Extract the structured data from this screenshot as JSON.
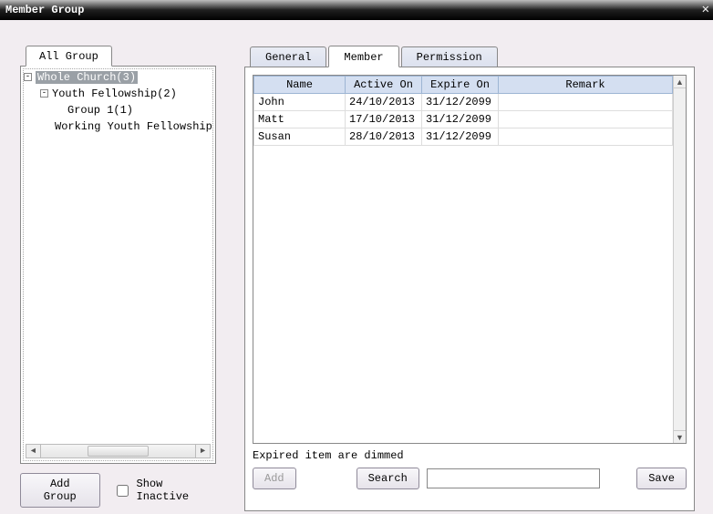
{
  "window": {
    "title": "Member Group"
  },
  "left": {
    "tab_label": "All Group",
    "tree": {
      "root_label": "Whole Church(3)",
      "items": [
        {
          "label": "Youth Fellowship(2)",
          "indent": 1,
          "expander": "-"
        },
        {
          "label": "Group 1(1)",
          "indent": 2,
          "expander": ""
        },
        {
          "label": "Working Youth Fellowship",
          "indent": 1,
          "expander": ""
        }
      ]
    },
    "add_group_label": "Add Group",
    "show_inactive_label": "Show Inactive"
  },
  "tabs": {
    "general": "General",
    "member": "Member",
    "permission": "Permission"
  },
  "table": {
    "headers": {
      "name": "Name",
      "active": "Active On",
      "expire": "Expire On",
      "remark": "Remark"
    },
    "rows": [
      {
        "name": "John",
        "active": "24/10/2013",
        "expire": "31/12/2099",
        "remark": ""
      },
      {
        "name": "Matt",
        "active": "17/10/2013",
        "expire": "31/12/2099",
        "remark": ""
      },
      {
        "name": "Susan",
        "active": "28/10/2013",
        "expire": "31/12/2099",
        "remark": ""
      }
    ]
  },
  "hint_text": "Expired item are dimmed",
  "buttons": {
    "add": "Add",
    "search": "Search",
    "save": "Save"
  },
  "search": {
    "value": ""
  }
}
